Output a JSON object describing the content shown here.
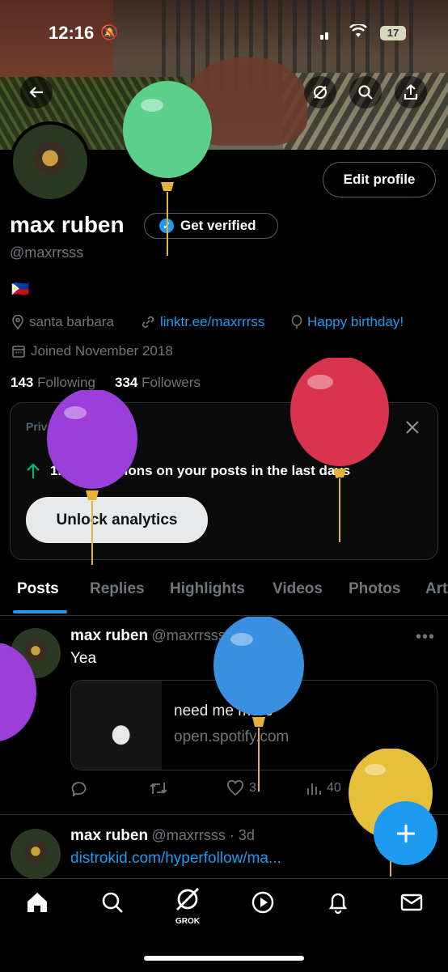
{
  "status_bar": {
    "time": "12:16",
    "battery": "17"
  },
  "header": {
    "icons": [
      "back-arrow-icon",
      "grok-icon",
      "search-icon",
      "share-icon"
    ]
  },
  "profile": {
    "edit_label": "Edit profile",
    "name": "max ruben",
    "verify_label": "Get verified",
    "handle": "@maxrrsss",
    "flag": "🇵🇭",
    "location": "santa barbara",
    "link": "linktr.ee/maxrrrss",
    "birthday": "Happy birthday!",
    "joined": "Joined November 2018",
    "following_count": "143",
    "following_label": "Following",
    "followers_count": "334",
    "followers_label": "Followers"
  },
  "analytics_card": {
    "private_label": "Private to you",
    "impressions_text": "1K impressions on your posts in the last days",
    "unlock_label": "Unlock analytics"
  },
  "tabs": [
    "Posts",
    "Replies",
    "Highlights",
    "Videos",
    "Photos",
    "Art"
  ],
  "posts": [
    {
      "name": "max ruben",
      "handle": "@maxrrsss · 2h",
      "text": "Yea",
      "card_title": "need me more",
      "card_domain": "open.spotify.com",
      "likes": "3",
      "views": "40"
    },
    {
      "name": "max ruben",
      "handle": "@maxrrsss · 3d",
      "text": "distrokid.com/hyperfollow/ma..."
    }
  ],
  "bottom_nav": {
    "grok_label": "GROK",
    "items": [
      "home-icon",
      "search-icon",
      "grok-icon",
      "video-icon",
      "notifications-icon",
      "messages-icon"
    ]
  },
  "balloons": [
    {
      "color": "#5ccf8a"
    },
    {
      "color": "#9b3fd8"
    },
    {
      "color": "#d8344e"
    },
    {
      "color": "#3b8fe0"
    },
    {
      "color": "#e6c03a"
    }
  ],
  "colors": {
    "accent": "#1d9bf0",
    "background": "#000000",
    "muted": "#71767b"
  }
}
